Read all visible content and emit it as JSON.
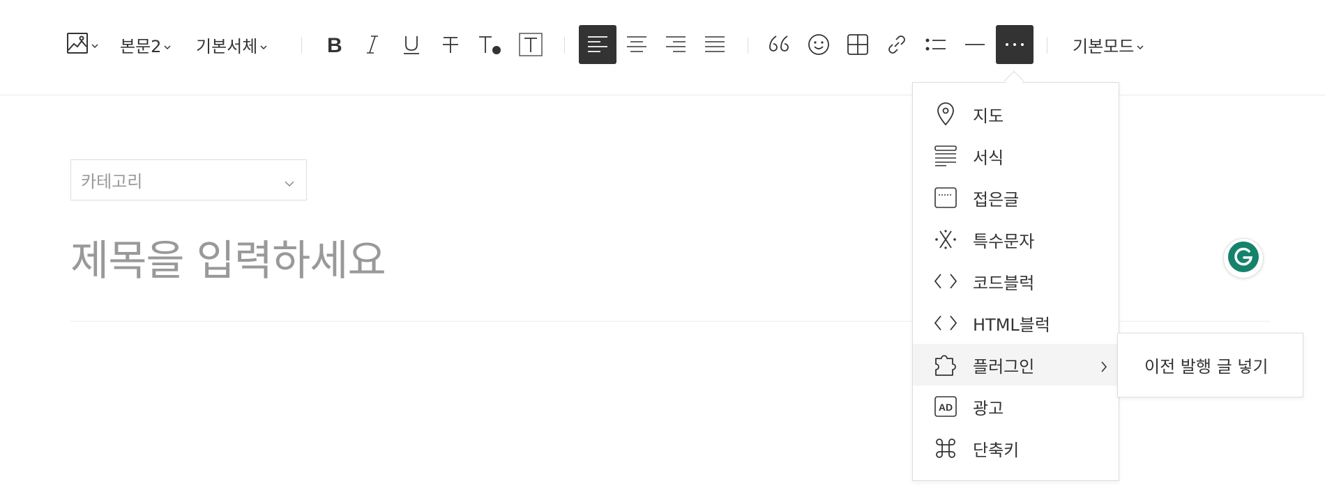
{
  "toolbar": {
    "image_icon": "image-icon",
    "paragraph_style": "본문2",
    "font_family": "기본서체",
    "buttons": {
      "bold": "bold-icon",
      "italic": "italic-icon",
      "underline": "underline-icon",
      "strikethrough": "strikethrough-icon",
      "text_color": "text-color-icon",
      "text_background": "text-background-icon",
      "align_left": "align-left-icon",
      "align_center": "align-center-icon",
      "align_right": "align-right-icon",
      "align_justify": "align-justify-icon",
      "quote": "quote-icon",
      "emoji": "emoji-icon",
      "table": "table-icon",
      "link": "link-icon",
      "list": "list-icon",
      "divider": "horizontal-rule-icon",
      "more": "more-icon"
    },
    "mode": "기본모드",
    "active_color": "#333333"
  },
  "editor": {
    "category_placeholder": "카테고리",
    "title_placeholder": "제목을 입력하세요",
    "placeholder_color": "#999999"
  },
  "more_menu": {
    "items": [
      {
        "label": "지도",
        "icon": "map-pin-icon"
      },
      {
        "label": "서식",
        "icon": "template-icon"
      },
      {
        "label": "접은글",
        "icon": "fold-text-icon"
      },
      {
        "label": "특수문자",
        "icon": "special-char-icon"
      },
      {
        "label": "코드블럭",
        "icon": "code-icon"
      },
      {
        "label": "HTML블럭",
        "icon": "html-code-icon"
      },
      {
        "label": "플러그인",
        "icon": "plugin-icon"
      },
      {
        "label": "광고",
        "icon": "ad-icon"
      },
      {
        "label": "단축키",
        "icon": "command-icon"
      }
    ],
    "hovered_item": "플러그인",
    "hover_bg": "#f4f4f4"
  },
  "plugin_submenu": {
    "items": [
      "이전 발행 글 넣기"
    ]
  },
  "grammarly": {
    "color": "#15826c",
    "icon": "grammarly-icon"
  }
}
